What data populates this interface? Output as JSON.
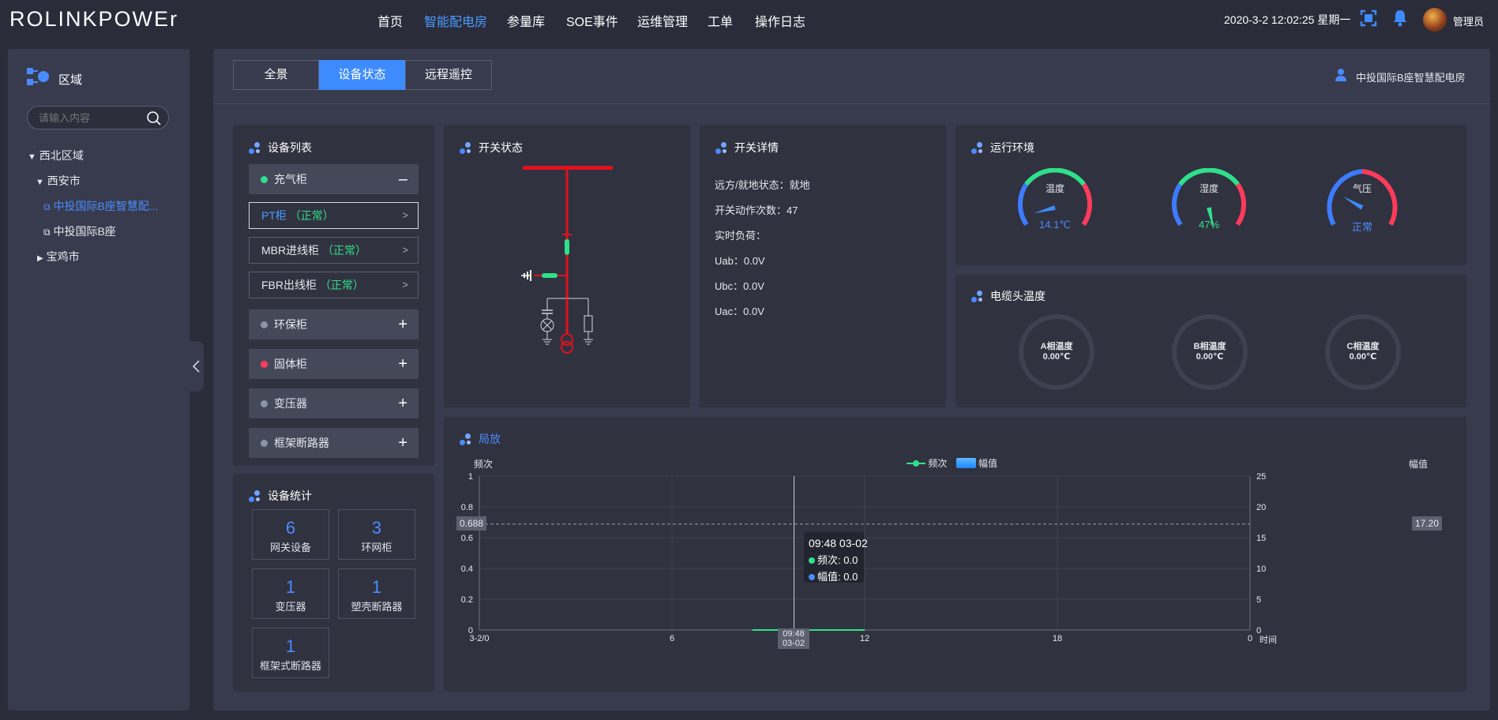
{
  "header": {
    "logo": "ROLINKPOWEr",
    "nav": [
      "首页",
      "智能配电房",
      "参量库",
      "SOE事件",
      "运维管理",
      "工单",
      "操作日志"
    ],
    "active_nav": 1,
    "datetime": "2020-3-2 12:02:25 星期一",
    "user": "管理员",
    "icons": [
      "fullscreen-icon",
      "bell-icon",
      "avatar"
    ]
  },
  "sidebar": {
    "title": "区域",
    "search_placeholder": "请输入内容",
    "tree": [
      {
        "label": "西北区域",
        "toggle": "▼"
      },
      {
        "label": "西安市",
        "toggle": "▼"
      },
      {
        "label": "中投国际B座智慧配...",
        "selected": true
      },
      {
        "label": "中投国际B座"
      },
      {
        "label": "宝鸡市",
        "toggle": "▶"
      }
    ]
  },
  "main": {
    "tabs": [
      "全景",
      "设备状态",
      "远程遥控"
    ],
    "active_tab": 1,
    "location": "中投国际B座智慧配电房"
  },
  "device_list": {
    "title": "设备列表",
    "groups": [
      {
        "name": "充气柜",
        "dot_color": "#2fe08b",
        "sign": "–",
        "expanded": true,
        "children": [
          {
            "name": "PT柜",
            "status": "（正常）",
            "active": true
          },
          {
            "name": "MBR进线柜",
            "status": "（正常）"
          },
          {
            "name": "FBR出线柜",
            "status": "（正常）"
          }
        ]
      },
      {
        "name": "环保柜",
        "dot_color": "#8a93a8",
        "sign": "+"
      },
      {
        "name": "固体柜",
        "dot_color": "#ff3b5c",
        "sign": "+"
      },
      {
        "name": "变压器",
        "dot_color": "#8a93a8",
        "sign": "+"
      },
      {
        "name": "框架断路器",
        "dot_color": "#8a93a8",
        "sign": "+"
      }
    ]
  },
  "device_stats": {
    "title": "设备统计",
    "items": [
      {
        "value": "6",
        "label": "网关设备"
      },
      {
        "value": "3",
        "label": "环网柜"
      },
      {
        "value": "1",
        "label": "变压器"
      },
      {
        "value": "1",
        "label": "塑壳断路器"
      },
      {
        "value": "1",
        "label": "框架式断路器"
      }
    ]
  },
  "switch_status": {
    "title": "开关状态"
  },
  "switch_detail": {
    "title": "开关详情",
    "lines": [
      "远方/就地状态：就地",
      "开关动作次数：47",
      "实时负荷：",
      "Uab：0.0V",
      "Ubc：0.0V",
      "Uac：0.0V"
    ]
  },
  "environment": {
    "title": "运行环境",
    "gauges": [
      {
        "label": "温度",
        "value": "14.1℃",
        "value_color": "#4a8bff",
        "pointer_deg": -105
      },
      {
        "label": "湿度",
        "value": "47%",
        "value_color": "#2fe08b",
        "pointer_deg": 168
      },
      {
        "label": "气压",
        "value": "正常",
        "value_color": "#4a8bff",
        "pointer_deg": -60
      }
    ],
    "colors": {
      "blue": "#3d7bff",
      "green": "#2fe08b",
      "red": "#ff3b5c"
    }
  },
  "cable_temp": {
    "title": "电缆头温度",
    "items": [
      {
        "label": "A相温度",
        "value": "0.00℃"
      },
      {
        "label": "B相温度",
        "value": "0.00℃"
      },
      {
        "label": "C相温度",
        "value": "0.00℃"
      }
    ]
  },
  "partial_discharge": {
    "title": "局放",
    "tooltip": {
      "title": "09:48 03-02",
      "rows": [
        "频次: 0.0",
        "幅值: 0.0"
      ]
    },
    "cursor_label": [
      "09:48",
      "03-02"
    ],
    "left_marker": "0.688",
    "right_marker": "17.20"
  },
  "chart_data": {
    "type": "line",
    "ylabel": "频次",
    "y2label": "幅值",
    "xlabel": "时间",
    "legend": [
      "频次",
      "幅值"
    ],
    "legend_position": "top-center",
    "x_ticks": [
      "3-2/0",
      "6",
      "12",
      "18",
      "0"
    ],
    "x_domain": [
      0,
      24
    ],
    "y_ticks": [
      "1",
      "0.8",
      "0.6",
      "0.4",
      "0.2",
      "0"
    ],
    "ylim": [
      0,
      1
    ],
    "y2_ticks": [
      "25",
      "20",
      "15",
      "10",
      "5",
      "0"
    ],
    "y2lim": [
      0,
      25
    ],
    "series": [
      {
        "name": "频次",
        "color": "#2fe08b",
        "x": [
          8.5,
          9.8,
          12
        ],
        "y": [
          0,
          0,
          0
        ]
      },
      {
        "name": "幅值",
        "color": "#4a8bff",
        "x": [
          9.8
        ],
        "y": [
          0
        ]
      }
    ],
    "cursor_x": 9.8,
    "crosshair_y": 0.688,
    "grid": true
  }
}
